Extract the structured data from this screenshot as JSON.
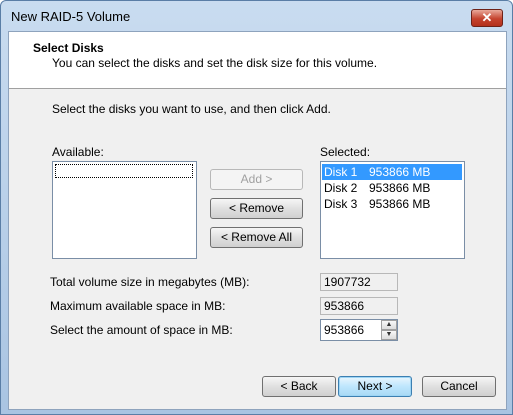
{
  "window": {
    "title": "New RAID-5 Volume"
  },
  "header": {
    "title": "Select Disks",
    "subtitle": "You can select the disks and set the disk size for this volume."
  },
  "instruction": "Select the disks you want to use, and then click Add.",
  "available": {
    "label": "Available:",
    "items": []
  },
  "selected": {
    "label": "Selected:",
    "items": [
      {
        "disk": "Disk 1",
        "size": "953866 MB",
        "selected": true
      },
      {
        "disk": "Disk 2",
        "size": "953866 MB",
        "selected": false
      },
      {
        "disk": "Disk 3",
        "size": "953866 MB",
        "selected": false
      }
    ]
  },
  "buttons": {
    "add": "Add >",
    "remove": "< Remove",
    "remove_all": "< Remove All",
    "back": "< Back",
    "next": "Next >",
    "cancel": "Cancel"
  },
  "fields": {
    "total_label": "Total volume size in megabytes (MB):",
    "total_value": "1907732",
    "max_label": "Maximum available space in MB:",
    "max_value": "953866",
    "amount_label": "Select the amount of space in MB:",
    "amount_value": "953866"
  }
}
